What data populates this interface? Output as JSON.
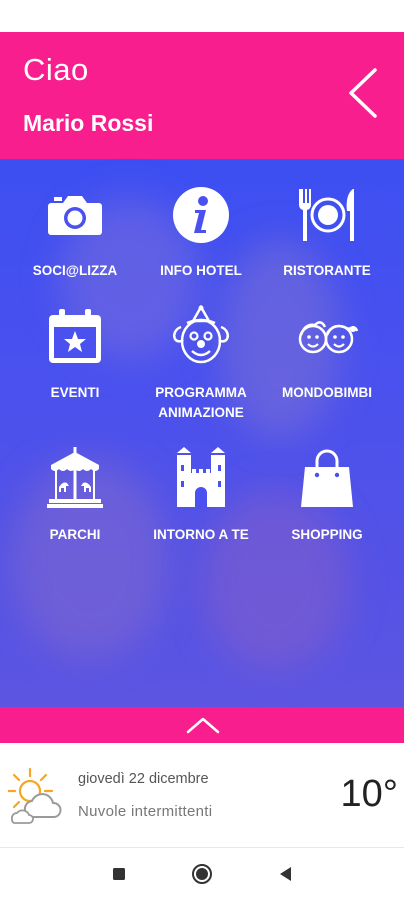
{
  "header": {
    "greeting": "Ciao",
    "username": "Mario Rossi",
    "color": "#f81e8e"
  },
  "menu": {
    "items": [
      {
        "label": "SOCI@LIZZA",
        "icon": "camera-icon"
      },
      {
        "label": "INFO HOTEL",
        "icon": "info-icon"
      },
      {
        "label": "RISTORANTE",
        "icon": "restaurant-icon"
      },
      {
        "label": "EVENTI",
        "icon": "calendar-star-icon"
      },
      {
        "label": "PROGRAMMA\nANIMAZIONE",
        "icon": "clown-icon"
      },
      {
        "label": "MONDOBIMBI",
        "icon": "kids-icon"
      },
      {
        "label": "PARCHI",
        "icon": "carousel-icon"
      },
      {
        "label": "INTORNO A TE",
        "icon": "castle-icon"
      },
      {
        "label": "SHOPPING",
        "icon": "shopping-bag-icon"
      }
    ],
    "background": "#4a51ee"
  },
  "weather": {
    "date": "giovedì 22 dicembre",
    "description": "Nuvole intermittenti",
    "temperature": "10°",
    "icon": "partly-cloudy-icon"
  },
  "navigation": {
    "buttons": [
      "recent-apps-icon",
      "home-icon",
      "back-nav-icon"
    ]
  }
}
